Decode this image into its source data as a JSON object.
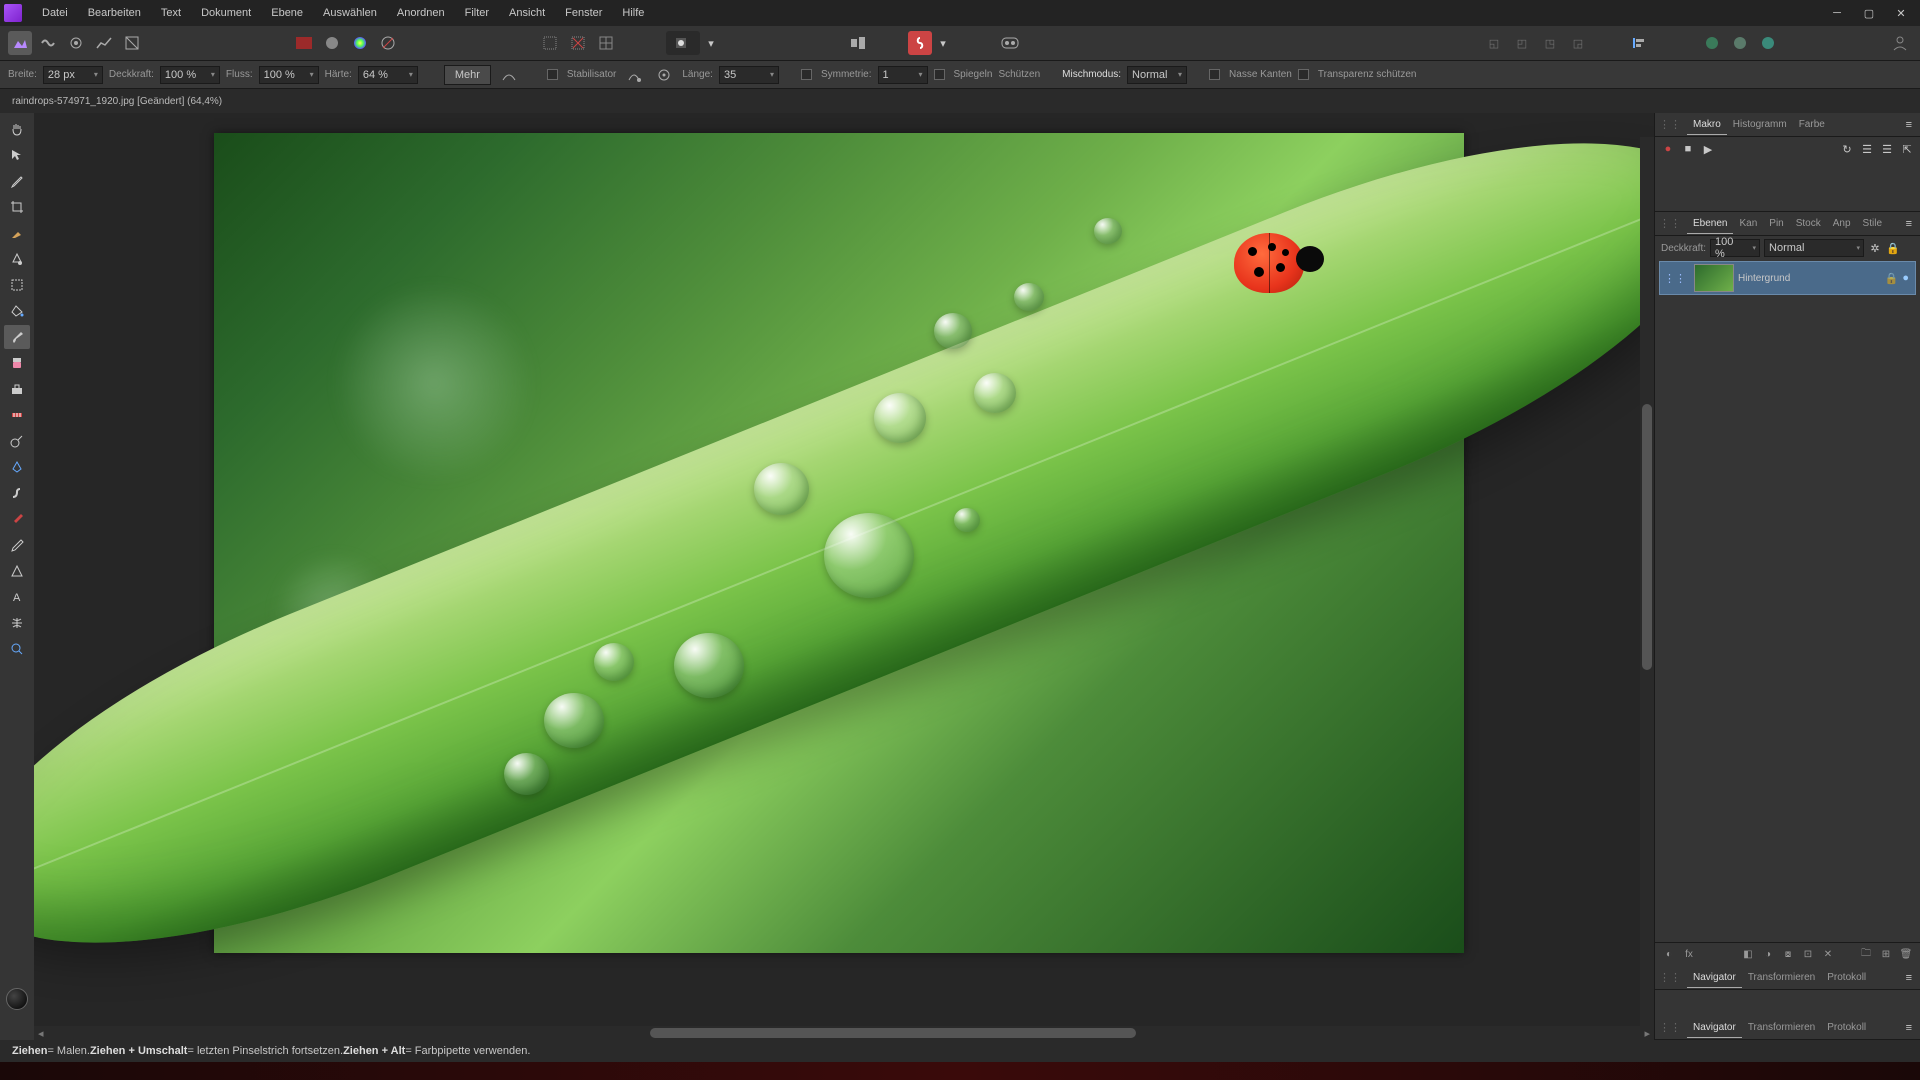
{
  "menu": [
    "Datei",
    "Bearbeiten",
    "Text",
    "Dokument",
    "Ebene",
    "Auswählen",
    "Anordnen",
    "Filter",
    "Ansicht",
    "Fenster",
    "Hilfe"
  ],
  "doc_tab": "raindrops-574971_1920.jpg [Geändert] (64,4%)",
  "context": {
    "breite_label": "Breite:",
    "breite": "28 px",
    "deckkraft_label": "Deckkraft:",
    "deckkraft": "100 %",
    "fluss_label": "Fluss:",
    "fluss": "100 %",
    "haerte_label": "Härte:",
    "haerte": "64 %",
    "mehr": "Mehr",
    "stabilisator": "Stabilisator",
    "laenge_label": "Länge:",
    "laenge": "35",
    "symmetrie_label": "Symmetrie:",
    "symmetrie": "1",
    "spiegeln": "Spiegeln",
    "schuetzen": "Schützen",
    "mischmodus_label": "Mischmodus:",
    "mischmodus": "Normal",
    "nasse": "Nasse Kanten",
    "transparenz": "Transparenz schützen"
  },
  "panels": {
    "top_tabs": [
      "Makro",
      "Histogramm",
      "Farbe"
    ],
    "layers_tabs": [
      "Ebenen",
      "Kan",
      "Pin",
      "Stock",
      "Anp",
      "Stile"
    ],
    "layers_deck_label": "Deckkraft:",
    "layers_deck": "100 %",
    "layers_blend": "Normal",
    "layer_name": "Hintergrund",
    "bottom_tabs1": [
      "Navigator",
      "Transformieren",
      "Protokoll"
    ],
    "bottom_tabs2": [
      "Navigator",
      "Transformieren",
      "Protokoll"
    ]
  },
  "status": {
    "s1": "Ziehen",
    "s1t": " = Malen. ",
    "s2": "Ziehen + Umschalt",
    "s2t": " = letzten Pinselstrich fortsetzen. ",
    "s3": "Ziehen + Alt",
    "s3t": " = Farbpipette verwenden."
  }
}
